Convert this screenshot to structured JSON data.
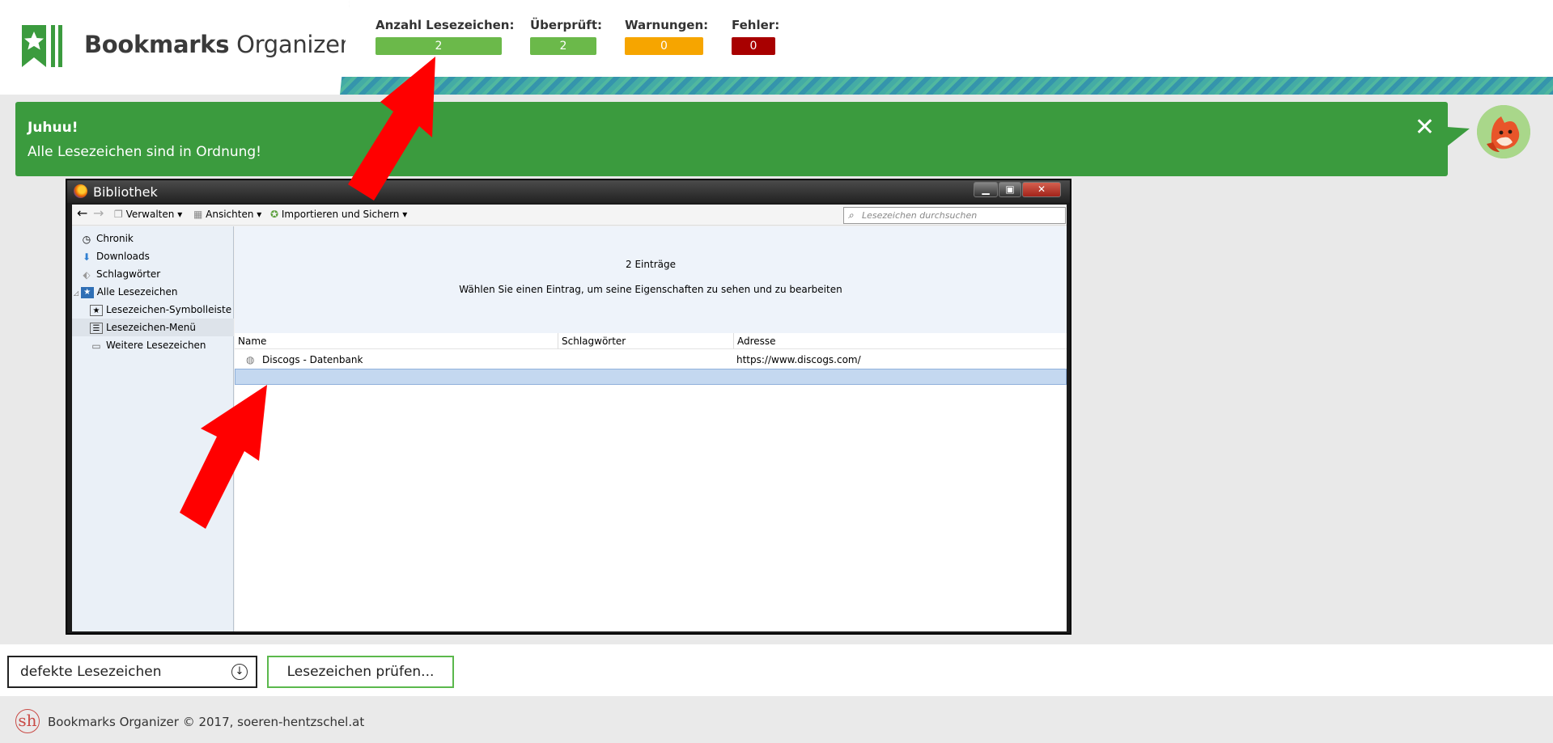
{
  "app": {
    "name_bold": "Bookmarks",
    "name_regular": " Organizer"
  },
  "stats": {
    "total": {
      "label": "Anzahl Lesezeichen:",
      "value": "2",
      "color": "#6bb94a"
    },
    "checked": {
      "label": "Überprüft:",
      "value": "2",
      "color": "#6bb94a"
    },
    "warnings": {
      "label": "Warnungen:",
      "value": "0",
      "color": "#f6a500"
    },
    "errors": {
      "label": "Fehler:",
      "value": "0",
      "color": "#a80000"
    }
  },
  "notification": {
    "title": "Juhuu!",
    "text": "Alle Lesezeichen sind in Ordnung!",
    "close": "✕",
    "color": "#3b9b3e"
  },
  "library": {
    "title": "Bibliothek",
    "toolbar": {
      "manage": "Verwalten",
      "views": "Ansichten",
      "import": "Importieren und Sichern",
      "search_placeholder": "Lesezeichen durchsuchen"
    },
    "sidebar": [
      {
        "label": "Chronik",
        "icon": "clock-icon",
        "glyph": "◷"
      },
      {
        "label": "Downloads",
        "icon": "download-arrow-icon",
        "glyph": "⬇"
      },
      {
        "label": "Schlagwörter",
        "icon": "tag-icon",
        "glyph": "🏷"
      },
      {
        "label": "Alle Lesezeichen",
        "icon": "bookmarks-star-icon",
        "glyph": "★"
      },
      {
        "label": "Lesezeichen-Symbolleiste",
        "icon": "toolbar-star-icon",
        "glyph": "★"
      },
      {
        "label": "Lesezeichen-Menü",
        "icon": "menu-list-icon",
        "glyph": "☰"
      },
      {
        "label": "Weitere Lesezeichen",
        "icon": "folder-icon",
        "glyph": "▭"
      }
    ],
    "info_count": "2 Einträge",
    "info_hint": "Wählen Sie einen Eintrag, um seine Eigenschaften zu sehen und zu bearbeiten",
    "columns": [
      "Name",
      "Schlagwörter",
      "Adresse"
    ],
    "rows": [
      {
        "name": "Discogs - Datenbank",
        "tags": "",
        "url": "https://www.discogs.com/"
      }
    ]
  },
  "controls": {
    "filter_value": "defekte Lesezeichen",
    "check_button": "Lesezeichen prüfen..."
  },
  "footer": {
    "logo": "sh",
    "text": "Bookmarks Organizer © 2017, soeren-hentzschel.at"
  }
}
